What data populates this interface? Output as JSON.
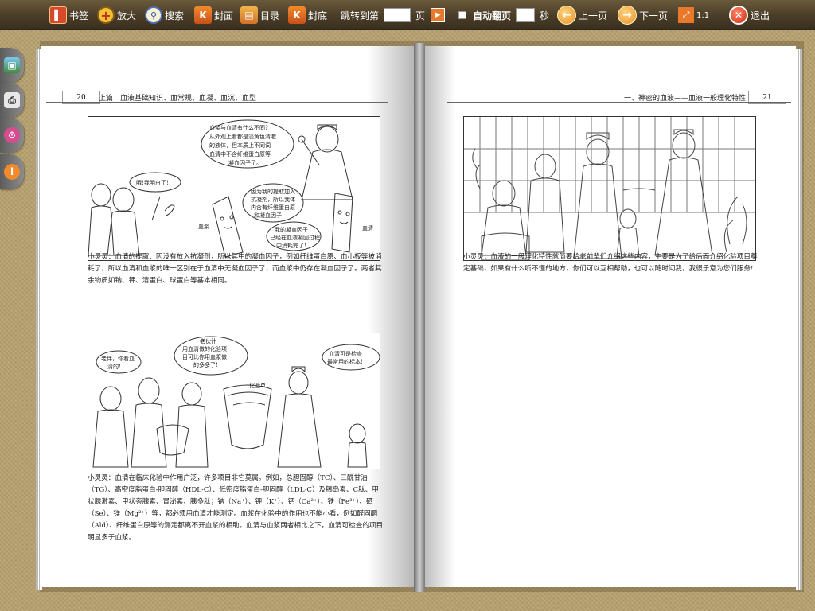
{
  "toolbar": {
    "bookmark": "书签",
    "zoom": "放大",
    "search": "搜索",
    "cover": "封面",
    "contents": "目录",
    "back_cover": "封底",
    "jump_prefix": "跳转到第",
    "jump_suffix": "页",
    "auto_flip": "自动翻页",
    "seconds": "秒",
    "prev_page": "上一页",
    "next_page": "下一页",
    "ratio": "1:1",
    "exit": "退出"
  },
  "left_page": {
    "page_number": "20",
    "running_head": "上篇　血液基础知识、血常规、血凝、血沉、血型",
    "panel1": {
      "bubble_doctor": [
        "血浆与血清有什么不同?",
        "从外观上看都是淡黄色清澈",
        "的液体，但本质上不同词",
        "血清中不含纤维蛋白原等",
        "凝血因子了。"
      ],
      "bubble_family": "哦!我明白了!",
      "bubble_plasma": [
        "因为我的提取加入",
        "抗凝剂，所以我体",
        "内含有纤维蛋白原",
        "和凝血因子!"
      ],
      "bubble_serum": [
        "我的凝血因子",
        "已经在血液凝固过程",
        "中消耗完了!"
      ],
      "label_plasma": "血浆",
      "label_serum": "血清"
    },
    "caption1": "小灵灵：血清的提取、因没有放入抗凝剂，所以其中的凝血因子，例如纤维蛋白原、血小板等被消耗了，所以血清和血浆的唯一区别在于血清中无凝血因子了，而血浆中仍存在凝血因子了。两者其余物质如钠、钾、清蛋白、球蛋白等基本相同。",
    "panel2": {
      "bubble_old": [
        "老伴，你看血",
        "清的!"
      ],
      "bubble_center": [
        "老伙计",
        "用血清做的化验项",
        "目可比你用血浆做",
        "的多多了!"
      ],
      "bubble_doctor": [
        "血清可是检查",
        "最常用的标本!"
      ],
      "paper_label": "化验单"
    },
    "caption2": "小灵灵：血清在临床化验中作用广泛，许多项目非它莫属。例如，总胆固醇（TC）、三酰甘油（TG）、高密度脂蛋白-胆固醇（HDL-C）、低密度脂蛋白-胆固醇（LDL-C）及胰岛素、C肽、甲状腺激素、甲状旁腺素、胃泌素、胰多肽；钠（Na⁺）、钾（K⁺）、钙（Ca²⁺）、铁（Fe³⁺）、硒（Se）、镁（Mg²⁺）等，都必须用血清才能测定。血浆在化验中的作用也不能小看，例如醛固酮（Ald）、纤维蛋白原等的测定都离不开血浆的相助。血清与血浆两者相比之下，血清可检查的项目明显多于血浆。"
  },
  "right_page": {
    "page_number": "21",
    "running_head": "一、神密的血液——血液一般理化特性",
    "caption": "小灵灵：血液的一般理化特性就简要给老前辈们介绍这些内容，主要是为了给后面介绍化验项目奠定基础，如果有什么听不懂的地方，你们可以互相帮助，也可以随时问我，我很乐意为您们服务!"
  },
  "side_tabs": [
    "image-icon",
    "print-icon",
    "settings-icon",
    "info-icon"
  ]
}
